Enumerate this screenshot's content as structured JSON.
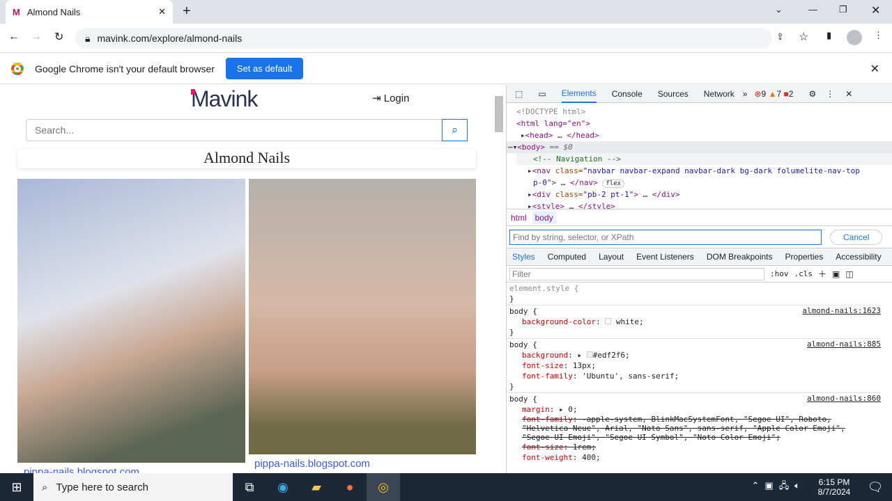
{
  "browser": {
    "tab_title": "Almond Nails",
    "url": "mavink.com/explore/almond-nails",
    "infobar_text": "Google Chrome isn't your default browser",
    "set_default": "Set as default"
  },
  "page": {
    "logo": "Mavink",
    "login": "Login",
    "search_placeholder": "Search...",
    "title": "Almond Nails",
    "cards": [
      {
        "source": "pippa-nails.blogspot.com"
      },
      {
        "source": "pippa-nails.blogspot.com"
      }
    ]
  },
  "devtools": {
    "tabs": [
      "Elements",
      "Console",
      "Sources",
      "Network"
    ],
    "errors": "9",
    "warnings": "7",
    "issues": "2",
    "dom": {
      "doctype": "<!DOCTYPE html>",
      "html": "<html lang=\"en\">",
      "head": "<head>",
      "head_close": "</head>",
      "body": "<body>",
      "body_sel": " == $0",
      "comment": "<!-- Navigation -->",
      "nav_tag": "<nav ",
      "nav_attr": "class=",
      "nav_val": "\"navbar navbar-expand navbar-dark bg-dark folumelite-nav-top",
      "nav_val2": "p-0\"",
      "nav_close": "</nav>",
      "flex": "flex",
      "div_tag": "<div ",
      "div_attr": "class=",
      "div_val": "\"pb-2 pt-1\"",
      "div_close": "</div>",
      "style": "<style>",
      "style_close": "</style>"
    },
    "breadcrumbs": [
      "html",
      "body"
    ],
    "find_placeholder": "Find by string, selector, or XPath",
    "cancel": "Cancel",
    "style_tabs": [
      "Styles",
      "Computed",
      "Layout",
      "Event Listeners",
      "DOM Breakpoints",
      "Properties",
      "Accessibility"
    ],
    "filter_placeholder": "Filter",
    "hov": ":hov",
    "cls": ".cls",
    "rules": {
      "element_style": "element.style {",
      "r1": {
        "sel": "body {",
        "src": "almond-nails:1623",
        "p1": "background-color",
        "v1": "white;"
      },
      "r2": {
        "sel": "body {",
        "src": "almond-nails:885",
        "p1": "background",
        "v1": "#edf2f6;",
        "p2": "font-size",
        "v2": "13px;",
        "p3": "font-family",
        "v3": "'Ubuntu', sans-serif;"
      },
      "r3": {
        "sel": "body {",
        "src": "almond-nails:860",
        "p1": "margin",
        "v1": "0;",
        "p2": "font-family",
        "v2": "-apple-system, BlinkMacSystemFont, \"Segoe UI\", Roboto, \"Helvetica Neue\", Arial, \"Noto Sans\", sans-serif, \"Apple Color Emoji\", \"Segoe UI Emoji\", \"Segoe UI Symbol\", \"Noto Color Emoji\";",
        "p3": "font-size",
        "v3": "1rem;",
        "p4": "font-weight",
        "v4": "400;"
      }
    }
  },
  "taskbar": {
    "search": "Type here to search",
    "time": "6:15 PM",
    "date": "8/7/2024"
  }
}
